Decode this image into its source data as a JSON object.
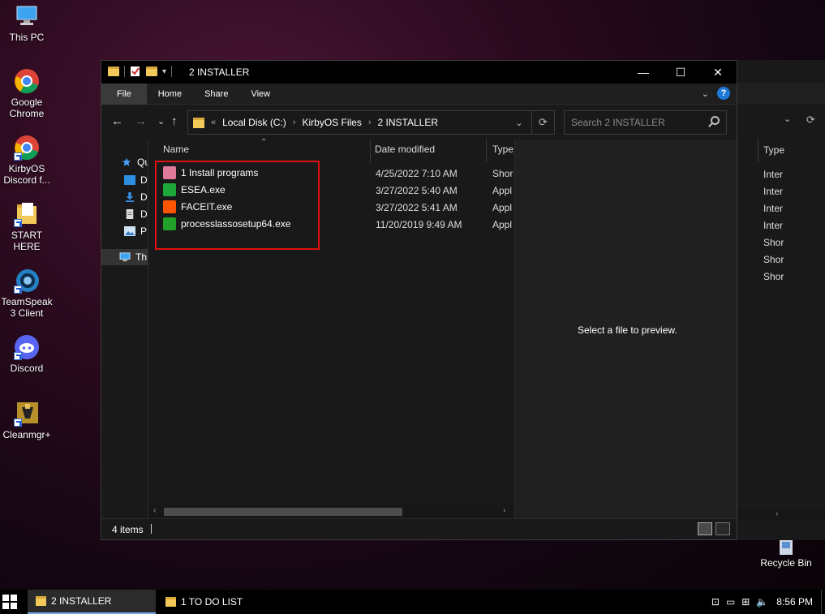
{
  "desktop": {
    "icons": [
      {
        "label": "This PC"
      },
      {
        "label": "Google Chrome"
      },
      {
        "label": "KirbyOS Discord f..."
      },
      {
        "label": "START HERE"
      },
      {
        "label": "TeamSpeak 3 Client"
      },
      {
        "label": "Discord"
      },
      {
        "label": "Cleanmgr+"
      },
      {
        "label": "Recycle Bin"
      }
    ]
  },
  "window": {
    "title": "2 INSTALLER",
    "controls": {
      "minimize": "—",
      "maximize": "☐",
      "close": "✕"
    },
    "ribbon": {
      "tabs": [
        {
          "label": "File"
        },
        {
          "label": "Home"
        },
        {
          "label": "Share"
        },
        {
          "label": "View"
        }
      ],
      "help": "?"
    },
    "nav": {
      "back": "←",
      "forward": "→",
      "recent": "⌄",
      "up": "↑"
    },
    "address": {
      "prefix": "«",
      "crumbs": [
        "Local Disk (C:)",
        "KirbyOS Files",
        "2 INSTALLER"
      ],
      "separator": "›",
      "dropdown": "⌄",
      "refresh": "⟳"
    },
    "search": {
      "placeholder": "Search 2 INSTALLER"
    },
    "nav_pane": {
      "items": [
        {
          "label": "Qu",
          "icon": "star-icon"
        },
        {
          "label": "D",
          "icon": "desktop-icon"
        },
        {
          "label": "D",
          "icon": "download-icon"
        },
        {
          "label": "D",
          "icon": "document-icon"
        },
        {
          "label": "P",
          "icon": "picture-icon"
        },
        {
          "label": "Th",
          "icon": "pc-icon"
        }
      ]
    },
    "columns": {
      "name": "Name",
      "date": "Date modified",
      "type": "Type"
    },
    "files": [
      {
        "name": "1 Install programs",
        "date": "4/25/2022 7:10 AM",
        "type": "Shor",
        "icon": "shortcut-heart-icon",
        "color": "#e07a9a"
      },
      {
        "name": "ESEA.exe",
        "date": "3/27/2022 5:40 AM",
        "type": "Appl",
        "icon": "esea-icon",
        "color": "#1fa83a"
      },
      {
        "name": "FACEIT.exe",
        "date": "3/27/2022 5:41 AM",
        "type": "Appl",
        "icon": "faceit-icon",
        "color": "#ff5500"
      },
      {
        "name": "processlassosetup64.exe",
        "date": "11/20/2019 9:49 AM",
        "type": "Appl",
        "icon": "process-lasso-icon",
        "color": "#22a02a"
      }
    ],
    "preview": {
      "text": "Select a file to preview."
    },
    "status": {
      "count": "4 items"
    }
  },
  "bg_window": {
    "type_header": "Type",
    "types": [
      "Inter",
      "Inter",
      "Inter",
      "Inter",
      "Shor",
      "Shor",
      "Shor"
    ]
  },
  "taskbar": {
    "items": [
      {
        "label": "2 INSTALLER",
        "active": true
      },
      {
        "label": "1 TO DO LIST",
        "active": false
      }
    ],
    "time": "8:56 PM"
  }
}
